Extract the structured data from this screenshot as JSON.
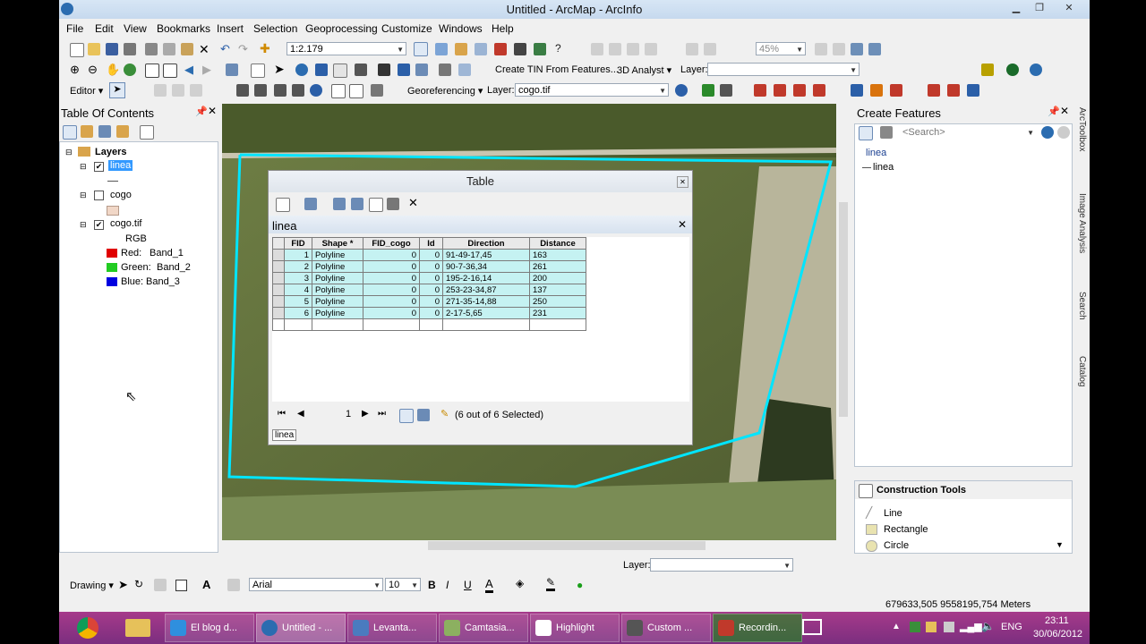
{
  "window": {
    "title": "Untitled - ArcMap - ArcInfo"
  },
  "menu": [
    "File",
    "Edit",
    "View",
    "Bookmarks",
    "Insert",
    "Selection",
    "Geoprocessing",
    "Customize",
    "Windows",
    "Help"
  ],
  "toolbar1": {
    "scale": "1:2.179",
    "zoom_percent": "45%"
  },
  "toolbar2": {
    "tin_label": "Create TIN From Features...",
    "analyst_label": "3D Analyst",
    "layer_label": "Layer:"
  },
  "toolbar3": {
    "editor_label": "Editor",
    "georef_label": "Georeferencing",
    "layer_label": "Layer:",
    "layer_value": "cogo.tif"
  },
  "toc": {
    "title": "Table Of Contents",
    "root": "Layers",
    "layers": [
      {
        "name": "linea",
        "checked": true
      },
      {
        "name": "cogo",
        "checked": false
      },
      {
        "name": "cogo.tif",
        "checked": true
      }
    ],
    "rgb_label": "RGB",
    "bands": [
      {
        "label": "Red:",
        "band": "Band_1",
        "color": "#e00000"
      },
      {
        "label": "Green:",
        "band": "Band_2",
        "color": "#22cc22"
      },
      {
        "label": "Blue:",
        "band": "Band_3",
        "color": "#0000e0"
      }
    ]
  },
  "table": {
    "window_title": "Table",
    "layer_name": "linea",
    "columns": [
      "FID",
      "Shape *",
      "FID_cogo",
      "Id",
      "Direction",
      "Distance"
    ],
    "rows": [
      [
        "1",
        "Polyline",
        "0",
        "0",
        "91-49-17,45",
        "163"
      ],
      [
        "2",
        "Polyline",
        "0",
        "0",
        "90-7-36,34",
        "261"
      ],
      [
        "3",
        "Polyline",
        "0",
        "0",
        "195-2-16,14",
        "200"
      ],
      [
        "4",
        "Polyline",
        "0",
        "0",
        "253-23-34,87",
        "137"
      ],
      [
        "5",
        "Polyline",
        "0",
        "0",
        "271-35-14,88",
        "250"
      ],
      [
        "6",
        "Polyline",
        "0",
        "0",
        "2-17-5,65",
        "231"
      ]
    ],
    "record": "1",
    "selection_text": "(6 out of 6 Selected)",
    "tab_label": "linea"
  },
  "create_features": {
    "title": "Create Features",
    "search_placeholder": "<Search>",
    "group": "linea",
    "template": "linea"
  },
  "construction_tools": {
    "title": "Construction Tools",
    "tools": [
      "Line",
      "Rectangle",
      "Circle"
    ]
  },
  "right_tabs": [
    "ArcToolbox",
    "Image Analysis",
    "Search",
    "Catalog"
  ],
  "bottom": {
    "layer_label": "Layer:",
    "drawing_label": "Drawing",
    "font": "Arial",
    "font_size": "10",
    "coords": "679633,505  9558195,754 Meters"
  },
  "taskbar": {
    "items": [
      "El blog d...",
      "Untitled - ...",
      "Levanta...",
      "Camtasia...",
      "Highlight",
      "Custom ...",
      "Recordin..."
    ],
    "lang": "ENG",
    "time": "23:11",
    "date": "30/06/2012"
  },
  "colors": {
    "selection": "#c5f2f2",
    "line": "#00e5ff",
    "taskbar": "#8d3384"
  }
}
